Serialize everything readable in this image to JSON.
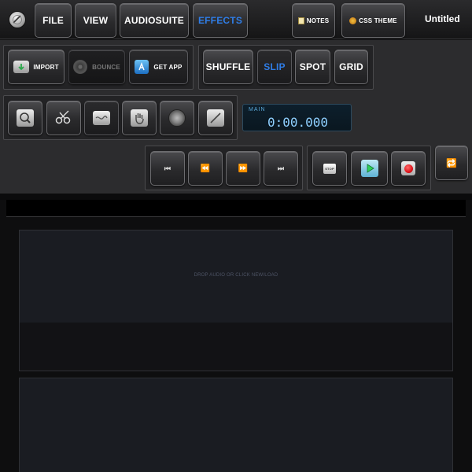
{
  "menu": {
    "file": "FILE",
    "view": "VIEW",
    "audiosuite": "AUDIOSUITE",
    "effects": "EFFECTS",
    "notes": "NOTES",
    "css_theme": "CSS THEME",
    "title": "Untitled"
  },
  "tools": {
    "import": "IMPORT",
    "bounce": "BOUNCE",
    "get_app": "GET APP"
  },
  "modes": {
    "shuffle": "SHUFFLE",
    "slip": "SLIP",
    "spot": "SPOT",
    "grid": "GRID",
    "selected": "SLIP"
  },
  "counter": {
    "label": "MAIN",
    "value": "0:00.000"
  },
  "transport": {
    "stop": "STOP"
  },
  "tracks": {
    "drop_hint": "DROP AUDIO OR CLICK NEW/LOAD"
  },
  "colors": {
    "accent_blue": "#2f7de6",
    "counter_text": "#8fd0ff",
    "record_red": "#e0151c",
    "play_green": "#2fcf5a",
    "loop_orange": "#f0a020"
  }
}
